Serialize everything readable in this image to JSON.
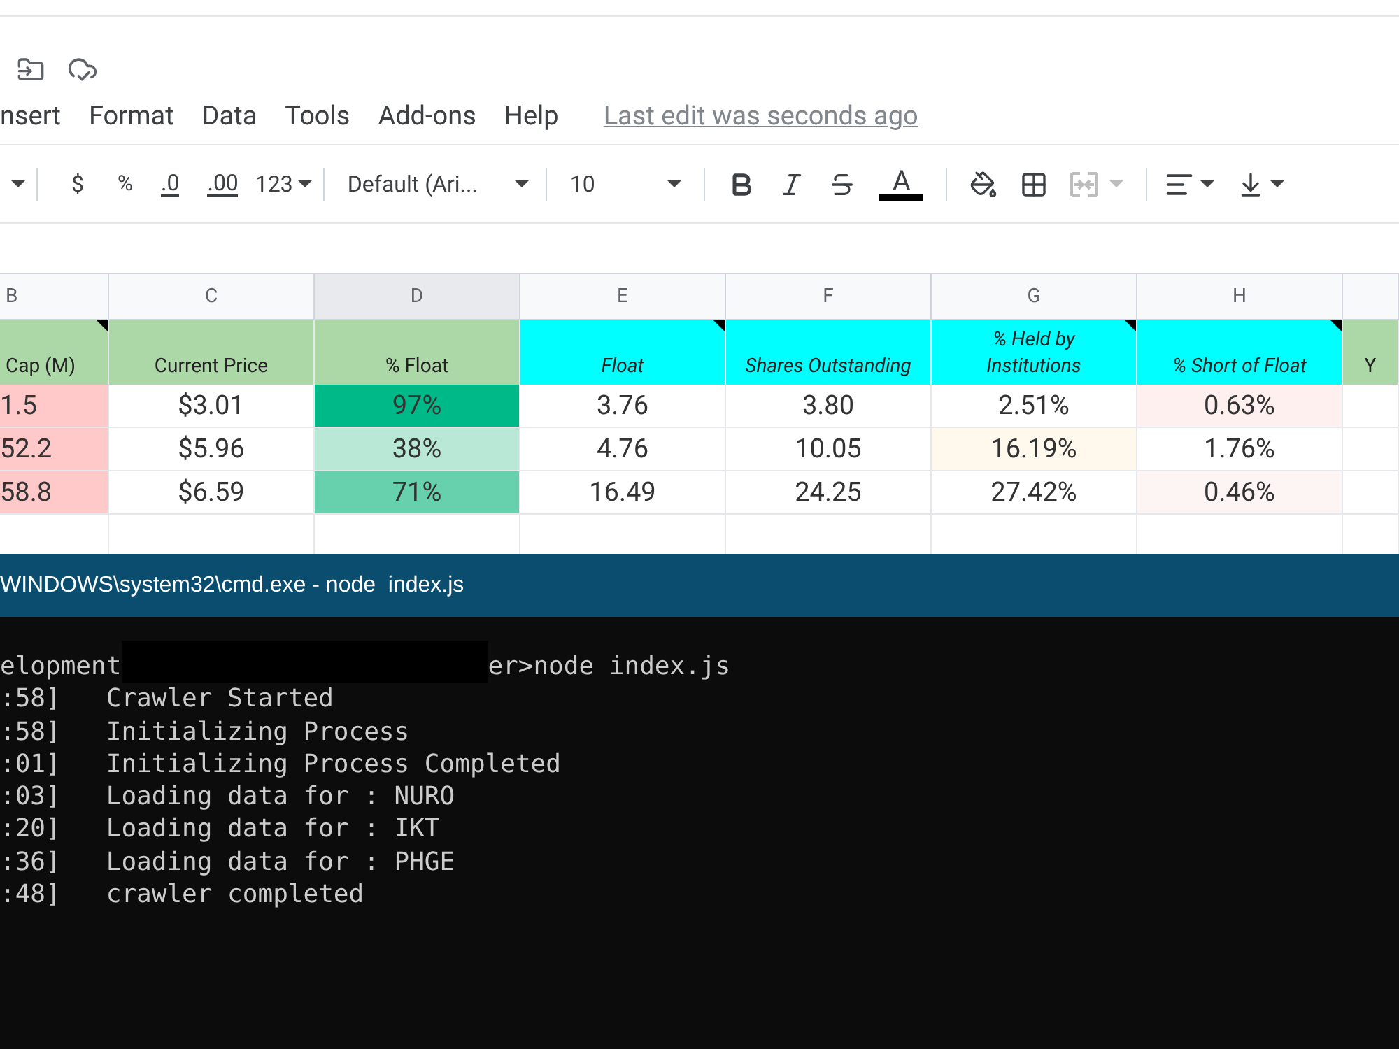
{
  "menu": {
    "items": [
      "nsert",
      "Format",
      "Data",
      "Tools",
      "Add-ons",
      "Help"
    ],
    "last_edit": "Last edit was seconds ago"
  },
  "toolbar": {
    "currency": "$",
    "percent": "%",
    "decrease_decimals": ".0",
    "increase_decimals": ".00",
    "more_formats": "123",
    "font": "Default (Ari...",
    "font_size": "10",
    "text_color_letter": "A",
    "merge_disabled": true
  },
  "sheet": {
    "columns": [
      {
        "letter": "B",
        "selected": false
      },
      {
        "letter": "C",
        "selected": false
      },
      {
        "letter": "D",
        "selected": true
      },
      {
        "letter": "E",
        "selected": false
      },
      {
        "letter": "F",
        "selected": false
      },
      {
        "letter": "G",
        "selected": false
      },
      {
        "letter": "H",
        "selected": false
      }
    ],
    "header_row": [
      {
        "text": "Cap (M)",
        "color": "#acd7a6",
        "italic": false,
        "note": true
      },
      {
        "text": "Current Price",
        "color": "#acd7a6",
        "italic": false,
        "note": false
      },
      {
        "text": "% Float",
        "color": "#acd7a6",
        "italic": false,
        "note": false
      },
      {
        "text": "Float",
        "color": "#00ffff",
        "italic": true,
        "note": true
      },
      {
        "text": "Shares Outstanding",
        "color": "#00ffff",
        "italic": true,
        "note": false
      },
      {
        "text": "% Held by Institutions",
        "color": "#00ffff",
        "italic": true,
        "note": true
      },
      {
        "text": "% Short of Float",
        "color": "#00ffff",
        "italic": true,
        "note": true
      },
      {
        "text": "Y",
        "color": "#acd7a6",
        "italic": false,
        "note": false
      }
    ],
    "rows": [
      [
        {
          "text": "1.5",
          "color": "#ffc9c9"
        },
        {
          "text": "$3.01",
          "color": "#ffffff"
        },
        {
          "text": "97%",
          "color": "#00b988"
        },
        {
          "text": "3.76",
          "color": "#ffffff"
        },
        {
          "text": "3.80",
          "color": "#ffffff"
        },
        {
          "text": "2.51%",
          "color": "#ffffff"
        },
        {
          "text": "0.63%",
          "color": "#fdf0ef"
        }
      ],
      [
        {
          "text": "52.2",
          "color": "#ffc9c9"
        },
        {
          "text": "$5.96",
          "color": "#ffffff"
        },
        {
          "text": "38%",
          "color": "#b9e8d6"
        },
        {
          "text": "4.76",
          "color": "#ffffff"
        },
        {
          "text": "10.05",
          "color": "#ffffff"
        },
        {
          "text": "16.19%",
          "color": "#fff8ec"
        },
        {
          "text": "1.76%",
          "color": "#ffffff"
        }
      ],
      [
        {
          "text": "58.8",
          "color": "#ffc9c9"
        },
        {
          "text": "$6.59",
          "color": "#ffffff"
        },
        {
          "text": "71%",
          "color": "#67d1ae"
        },
        {
          "text": "16.49",
          "color": "#ffffff"
        },
        {
          "text": "24.25",
          "color": "#ffffff"
        },
        {
          "text": "27.42%",
          "color": "#ffffff"
        },
        {
          "text": "0.46%",
          "color": "#fdf5f4"
        }
      ]
    ]
  },
  "terminal": {
    "title": "WINDOWS\\system32\\cmd.exe - node  index.js",
    "prompt_start": "elopment",
    "prompt_end": "er>node index.js",
    "lines": [
      ":58]   Crawler Started",
      ":58]   Initializing Process",
      ":01]   Initializing Process Completed",
      ":03]   Loading data for : NURO",
      ":20]   Loading data for : IKT",
      ":36]   Loading data for : PHGE",
      ":48]   crawler completed"
    ]
  }
}
